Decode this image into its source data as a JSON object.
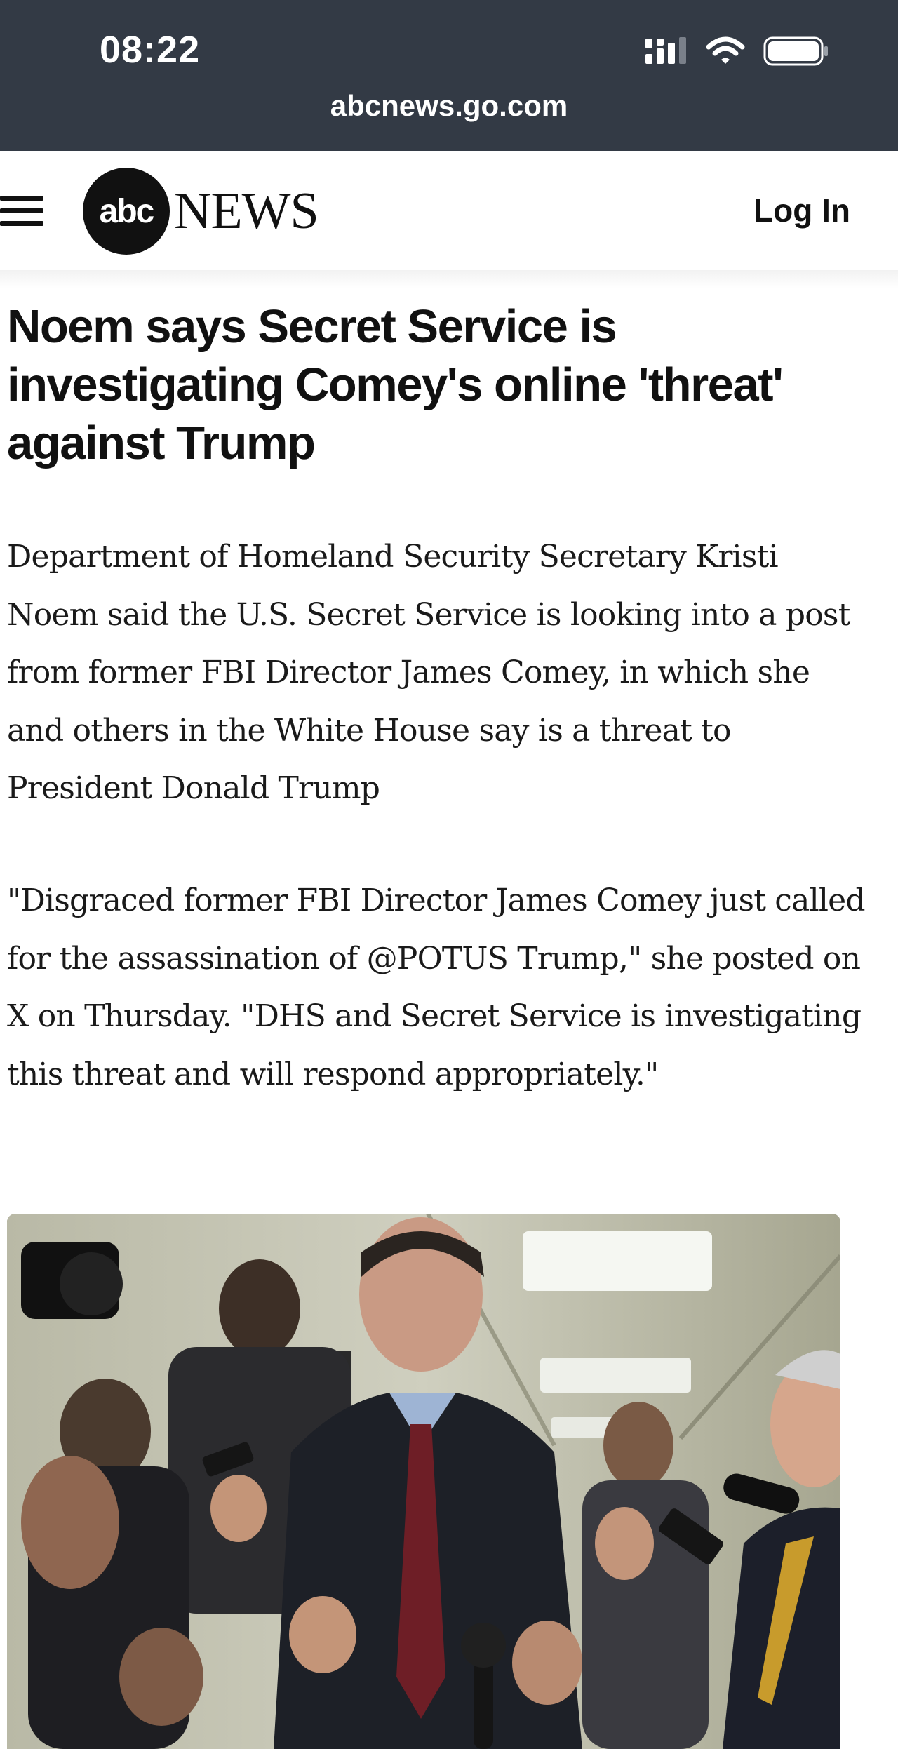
{
  "status_bar": {
    "time": "08:22",
    "signal_icon": "cellular-signal-icon",
    "wifi_icon": "wifi-icon",
    "battery_icon": "battery-icon"
  },
  "browser": {
    "url": "abcnews.go.com"
  },
  "header": {
    "menu_icon": "hamburger-menu-icon",
    "logo_circle": "abc",
    "logo_word": "NEWS",
    "login_label": "Log In"
  },
  "article": {
    "headline": "Noem says Secret Service is investigating Comey's online 'threat' against Trump",
    "paragraphs": [
      "Department of Homeland Security Secretary Kristi Noem said the U.S. Secret Service is looking into a post from former FBI Director James Comey, in which she and others in the White House say is a threat to President Donald Trump",
      "\"Disgraced former FBI Director James Comey just called for the assassination of @POTUS Trump,\" she posted on X on Thursday. \"DHS and Secret Service is investigating this threat and will respond appropriately.\""
    ]
  },
  "colors": {
    "status_bar_bg": "#333a45",
    "text": "#111111"
  }
}
